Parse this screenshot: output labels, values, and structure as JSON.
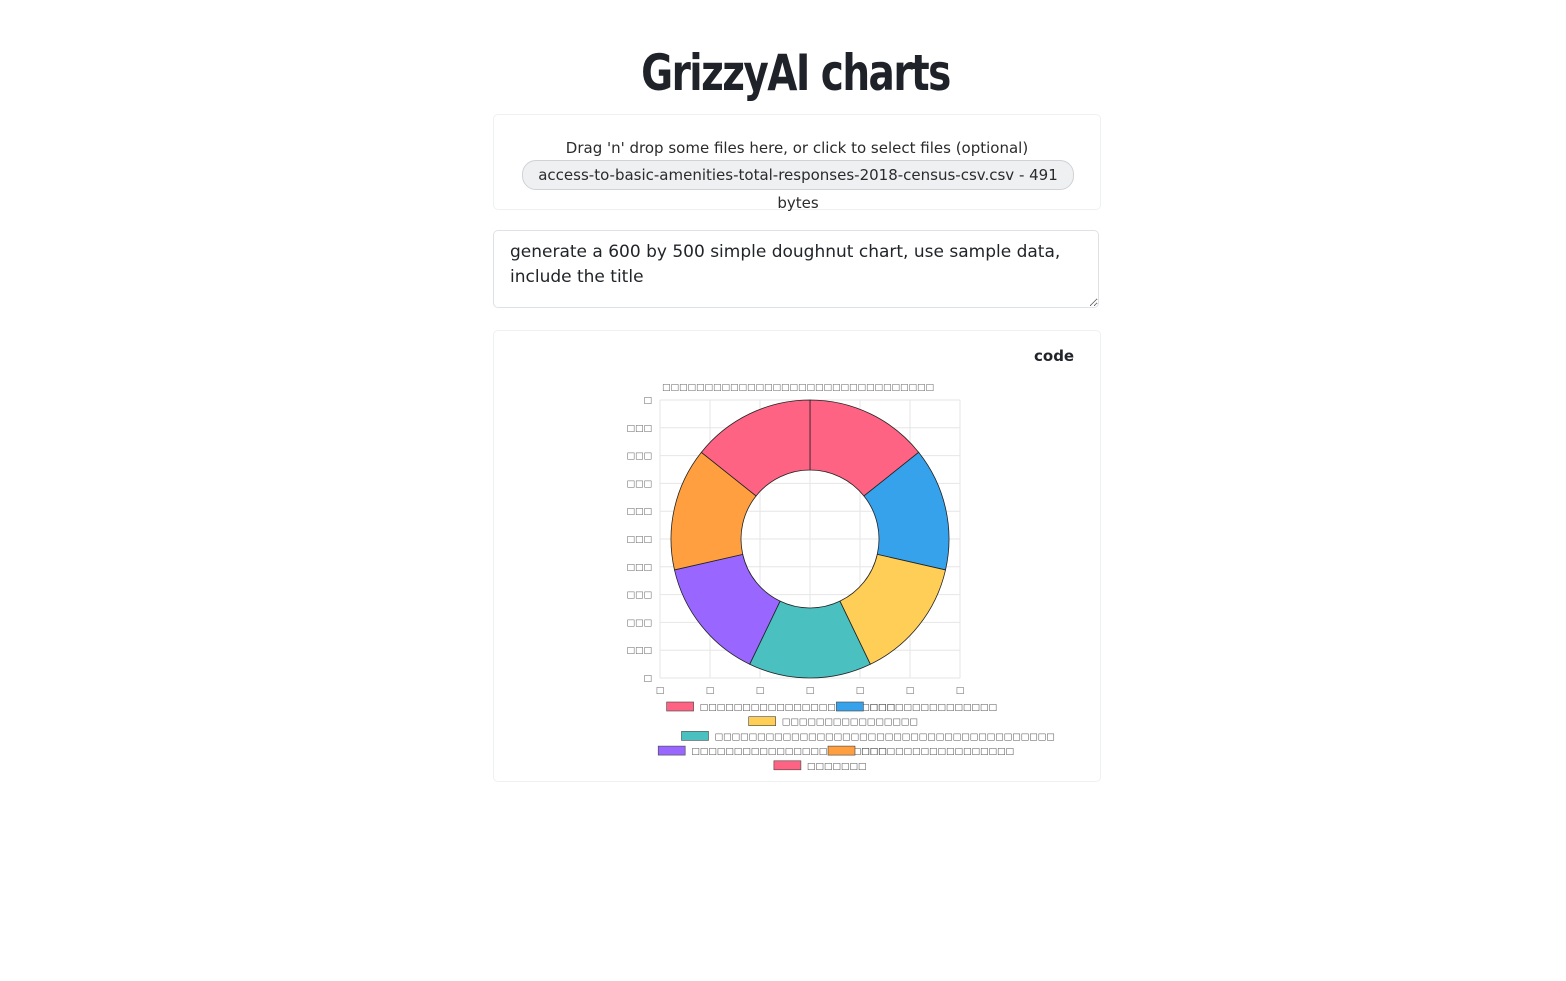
{
  "header": {
    "title": "GrizzyAI charts"
  },
  "dropzone": {
    "instructions": "Drag 'n' drop some files here, or click to select files (optional)",
    "file_label": "access-to-basic-amenities-total-responses-2018-census-csv.csv - 491 bytes"
  },
  "prompt": {
    "value": "generate a 600 by 500 simple doughnut chart, use sample data, include the title"
  },
  "result": {
    "code_label": "code"
  },
  "chart_data": {
    "type": "pie",
    "note_text_rendering": "All chart text renders as missing-glyph boxes",
    "title": "□□□□□□□□□□□□□□□□□□□□□□□□□□□□□□□□",
    "labels": [
      "□□□□□□□□□□□□□□□□□□□□□□□",
      "□□□□□□□□□□□□□□□",
      "□□□□□□□□□□□□□□□□",
      "□□□□□□□□□□□□□□□□□□□□□□□□□□□□□□□□□□□□□□□□",
      "□□□□□□□□□□□□□□□□□□□□□□□",
      "□□□□□□□□□□□□□□□□□□",
      "□□□□□□□"
    ],
    "values": [
      1,
      1,
      1,
      1,
      1,
      1,
      1
    ],
    "colors": [
      "#ff6384",
      "#36a2eb",
      "#ffce56",
      "#4bc0c0",
      "#9966ff",
      "#ff9f40",
      "#ff6384"
    ],
    "y_ticks": [
      "□",
      "□□□",
      "□□□",
      "□□□",
      "□□□",
      "□□□",
      "□□□",
      "□□□",
      "□□□",
      "□□□",
      "□"
    ],
    "x_ticks": [
      "□",
      "□",
      "□",
      "□",
      "□",
      "□",
      "□"
    ],
    "grid": true,
    "legend_position": "bottom"
  }
}
